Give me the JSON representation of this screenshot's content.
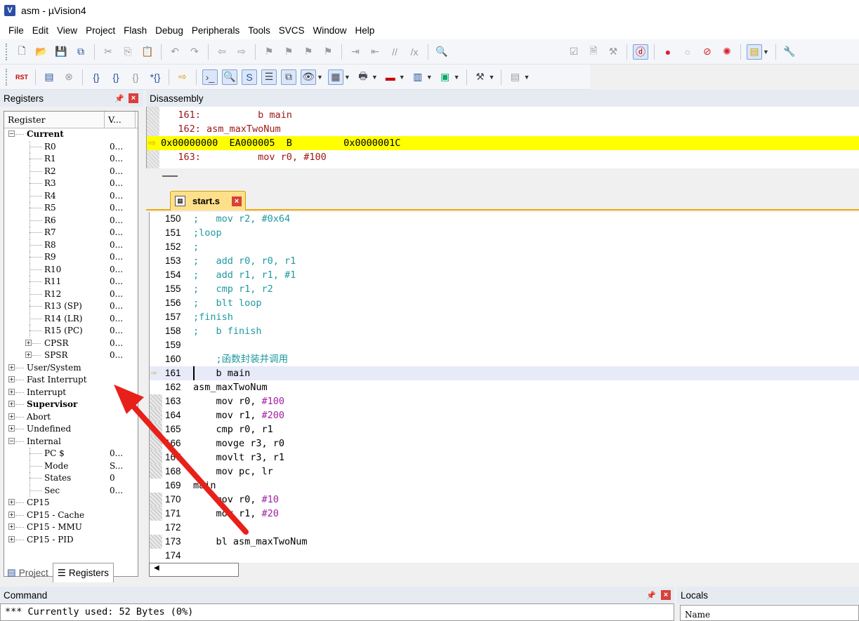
{
  "window": {
    "title": "asm  - µVision4",
    "icon_letter": "V"
  },
  "menu": [
    "File",
    "Edit",
    "View",
    "Project",
    "Flash",
    "Debug",
    "Peripherals",
    "Tools",
    "SVCS",
    "Window",
    "Help"
  ],
  "registers": {
    "title": "Registers",
    "columns": [
      "Register",
      "V..."
    ],
    "rows": [
      {
        "name": "Current",
        "value": "",
        "level": 0,
        "bold": true,
        "expander": "−"
      },
      {
        "name": "R0",
        "value": "0...",
        "level": 2
      },
      {
        "name": "R1",
        "value": "0...",
        "level": 2
      },
      {
        "name": "R2",
        "value": "0...",
        "level": 2
      },
      {
        "name": "R3",
        "value": "0...",
        "level": 2
      },
      {
        "name": "R4",
        "value": "0...",
        "level": 2
      },
      {
        "name": "R5",
        "value": "0...",
        "level": 2
      },
      {
        "name": "R6",
        "value": "0...",
        "level": 2
      },
      {
        "name": "R7",
        "value": "0...",
        "level": 2
      },
      {
        "name": "R8",
        "value": "0...",
        "level": 2
      },
      {
        "name": "R9",
        "value": "0...",
        "level": 2
      },
      {
        "name": "R10",
        "value": "0...",
        "level": 2
      },
      {
        "name": "R11",
        "value": "0...",
        "level": 2
      },
      {
        "name": "R12",
        "value": "0...",
        "level": 2
      },
      {
        "name": "R13 (SP)",
        "value": "0...",
        "level": 2
      },
      {
        "name": "R14 (LR)",
        "value": "0...",
        "level": 2
      },
      {
        "name": "R15 (PC)",
        "value": "0...",
        "level": 2
      },
      {
        "name": "CPSR",
        "value": "0...",
        "level": 1,
        "expander": "+"
      },
      {
        "name": "SPSR",
        "value": "0...",
        "level": 1,
        "expander": "+"
      },
      {
        "name": "User/System",
        "value": "",
        "level": 0,
        "expander": "+"
      },
      {
        "name": "Fast Interrupt",
        "value": "",
        "level": 0,
        "expander": "+"
      },
      {
        "name": "Interrupt",
        "value": "",
        "level": 0,
        "expander": "+"
      },
      {
        "name": "Supervisor",
        "value": "",
        "level": 0,
        "bold": true,
        "expander": "+"
      },
      {
        "name": "Abort",
        "value": "",
        "level": 0,
        "expander": "+"
      },
      {
        "name": "Undefined",
        "value": "",
        "level": 0,
        "expander": "+"
      },
      {
        "name": "Internal",
        "value": "",
        "level": 0,
        "expander": "−"
      },
      {
        "name": "PC  $",
        "value": "0...",
        "level": 2
      },
      {
        "name": "Mode",
        "value": "S...",
        "level": 2
      },
      {
        "name": "States",
        "value": "0",
        "level": 2
      },
      {
        "name": "Sec",
        "value": "0...",
        "level": 2
      },
      {
        "name": "CP15",
        "value": "",
        "level": 0,
        "expander": "+"
      },
      {
        "name": "CP15 - Cache",
        "value": "",
        "level": 0,
        "expander": "+"
      },
      {
        "name": "CP15 - MMU",
        "value": "",
        "level": 0,
        "expander": "+"
      },
      {
        "name": "CP15 - PID",
        "value": "",
        "level": 0,
        "expander": "+"
      }
    ],
    "tabs": [
      "Project",
      "Registers"
    ]
  },
  "disassembly": {
    "title": "Disassembly",
    "lines": [
      {
        "text": "   161:          b main",
        "type": "src"
      },
      {
        "text": "   162: asm_maxTwoNum",
        "type": "src"
      },
      {
        "text": "0x00000000  EA000005  B         0x0000001C",
        "type": "current"
      },
      {
        "text": "   163:          mov r0, #100",
        "type": "src"
      }
    ]
  },
  "editor": {
    "filename": "start.s",
    "current_line": 161,
    "lines": [
      {
        "n": "150",
        "parts": [
          [
            "cm",
            ";   mov r2, #0x64"
          ]
        ]
      },
      {
        "n": "151",
        "parts": [
          [
            "cm",
            ";loop"
          ]
        ]
      },
      {
        "n": "152",
        "parts": [
          [
            "cm",
            ";"
          ]
        ]
      },
      {
        "n": "153",
        "parts": [
          [
            "cm",
            ";   add r0, r0, r1"
          ]
        ]
      },
      {
        "n": "154",
        "parts": [
          [
            "cm",
            ";   add r1, r1, #1"
          ]
        ]
      },
      {
        "n": "155",
        "parts": [
          [
            "cm",
            ";   cmp r1, r2"
          ]
        ]
      },
      {
        "n": "156",
        "parts": [
          [
            "cm",
            ";   blt loop"
          ]
        ]
      },
      {
        "n": "157",
        "parts": [
          [
            "cm",
            ";finish"
          ]
        ]
      },
      {
        "n": "158",
        "parts": [
          [
            "cm",
            ";   b finish"
          ]
        ]
      },
      {
        "n": "159",
        "parts": []
      },
      {
        "n": "160",
        "parts": [
          [
            "cm",
            "    ;函数封装并调用"
          ]
        ]
      },
      {
        "n": "161",
        "parts": [
          [
            "kw",
            "    b main"
          ]
        ]
      },
      {
        "n": "162",
        "parts": [
          [
            "kw",
            "asm_maxTwoNum"
          ]
        ]
      },
      {
        "n": "163",
        "parts": [
          [
            "kw",
            "    mov r0, "
          ],
          [
            "num",
            "#100"
          ]
        ]
      },
      {
        "n": "164",
        "parts": [
          [
            "kw",
            "    mov r1, "
          ],
          [
            "num",
            "#200"
          ]
        ]
      },
      {
        "n": "165",
        "parts": [
          [
            "kw",
            "    cmp r0, r1"
          ]
        ]
      },
      {
        "n": "166",
        "parts": [
          [
            "kw",
            "    movge r3, r0"
          ]
        ]
      },
      {
        "n": "167",
        "parts": [
          [
            "kw",
            "    movlt r3, r1"
          ]
        ]
      },
      {
        "n": "168",
        "parts": [
          [
            "kw",
            "    mov pc, lr"
          ]
        ]
      },
      {
        "n": "169",
        "parts": [
          [
            "kw",
            "main"
          ]
        ]
      },
      {
        "n": "170",
        "parts": [
          [
            "kw",
            "    mov r0, "
          ],
          [
            "num",
            "#10"
          ]
        ]
      },
      {
        "n": "171",
        "parts": [
          [
            "kw",
            "    mov r1, "
          ],
          [
            "num",
            "#20"
          ]
        ]
      },
      {
        "n": "172",
        "parts": []
      },
      {
        "n": "173",
        "parts": [
          [
            "kw",
            "    bl asm_maxTwoNum"
          ]
        ]
      },
      {
        "n": "174",
        "parts": []
      }
    ],
    "marked_lines": [
      "163",
      "164",
      "165",
      "166",
      "167",
      "168",
      "170",
      "171",
      "173"
    ]
  },
  "command": {
    "title": "Command",
    "text": "*** Currently used: 52 Bytes (0%)"
  },
  "locals": {
    "title": "Locals",
    "column": "Name"
  },
  "colors": {
    "current_line": "#ffff00",
    "comment": "#1e9aa0",
    "number": "#a020a0",
    "arrow": "#e8201a"
  }
}
